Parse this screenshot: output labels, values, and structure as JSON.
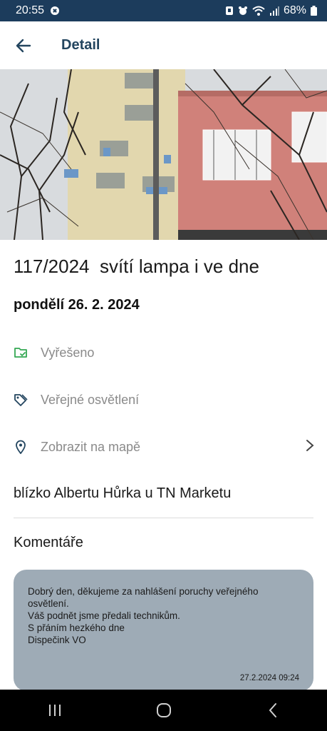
{
  "status_bar": {
    "time": "20:55",
    "battery": "68%",
    "icons": [
      "sync-icon",
      "alarm-icon",
      "wifi-icon",
      "signal-icon",
      "battery-icon"
    ]
  },
  "app_bar": {
    "title": "Detail",
    "back_icon": "arrow-left-icon"
  },
  "photo": {
    "icon": "building-photo"
  },
  "detail": {
    "title": "117/2024  svítí lampa i ve dne",
    "date": "pondělí 26. 2. 2024",
    "status": "Vyřešeno",
    "category": "Veřejné osvětlení",
    "map_link": "Zobrazit na mapě",
    "location": "blízko Albertu Hůrka u TN Marketu"
  },
  "colors": {
    "status_green": "#34a853",
    "icon_navy": "#23455f",
    "card_bg": "#9eabb6"
  },
  "comments": {
    "title": "Komentáře",
    "items": [
      {
        "lines": [
          "Dobrý den, děkujeme za nahlášení poruchy veřejného osvětlení.",
          "Váš podnět jsme předali technikům.",
          "S přáním hezkého dne",
          "Dispečink VO"
        ],
        "timestamp": "27.2.2024 09:24"
      }
    ]
  },
  "nav_bar": {
    "recents": "recents-icon",
    "home": "home-icon",
    "back": "back-icon"
  }
}
